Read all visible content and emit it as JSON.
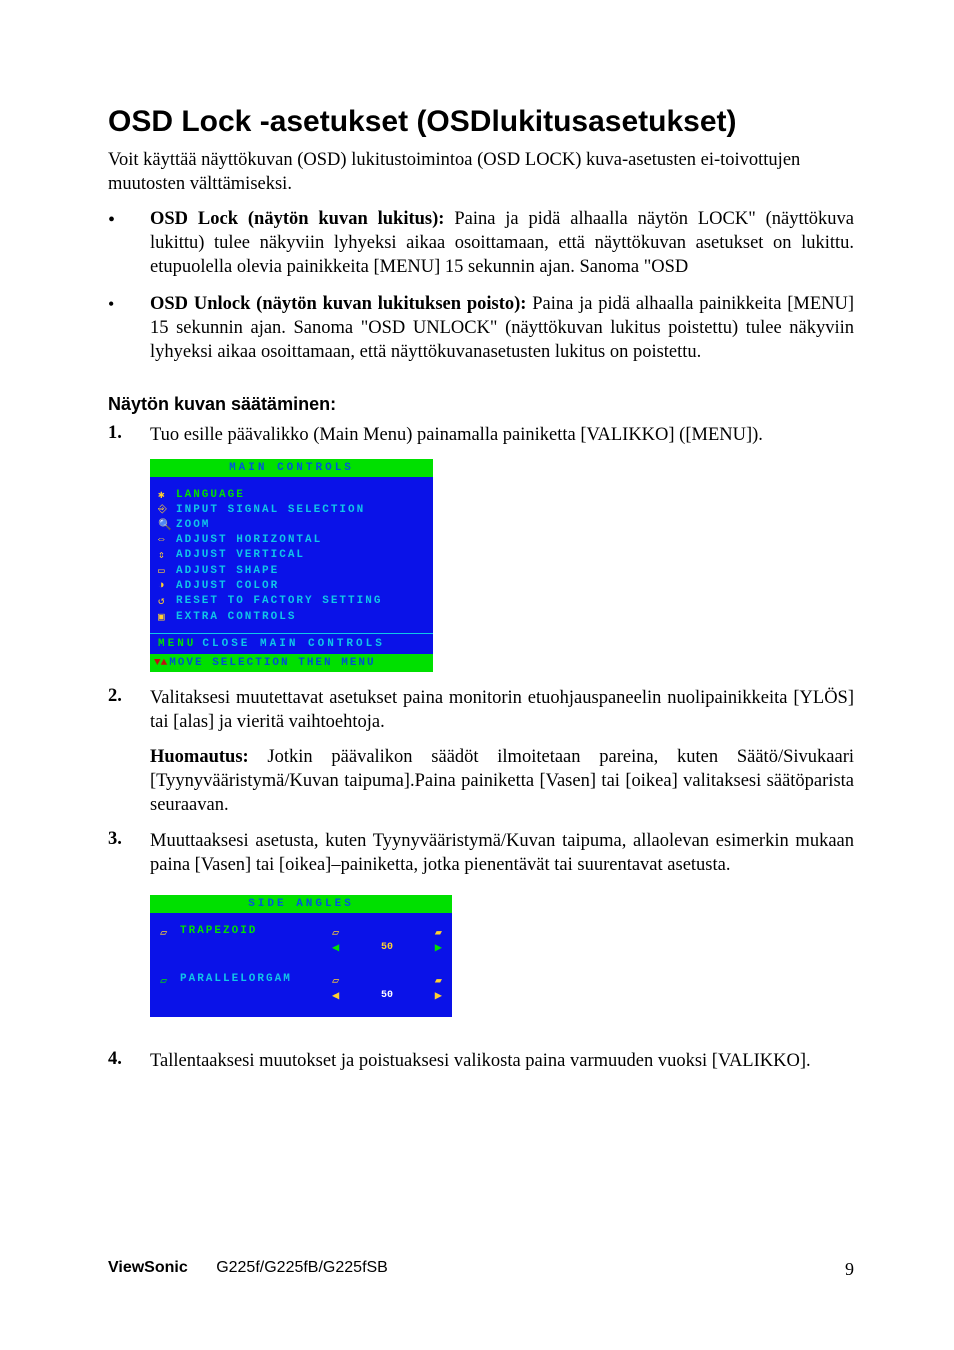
{
  "title": "OSD Lock -asetukset (OSDlukitusasetukset)",
  "intro": "Voit käyttää näyttökuvan (OSD) lukitustoimintoa (OSD LOCK) kuva-asetusten ei-toivottujen muutosten välttämiseksi.",
  "bullets": [
    {
      "lead": "OSD Lock (näytön kuvan lukitus):",
      "text": " Paina ja pidä alhaalla näytön LOCK\" (näyttökuva lukittu) tulee näkyviin lyhyeksi aikaa osoittamaan, että näyttökuvan asetukset on lukittu. etupuolella olevia painikkeita [MENU] 15 sekunnin ajan. Sanoma \"OSD"
    },
    {
      "lead": "OSD Unlock (näytön kuvan lukituksen poisto):",
      "text": " Paina ja pidä alhaalla painikkeita [MENU] 15 sekunnin ajan. Sanoma \"OSD UNLOCK\" (näyttökuvan lukitus poistettu) tulee näkyviin lyhyeksi aikaa osoittamaan, että näyttökuvanasetusten lukitus on poistettu."
    }
  ],
  "subhead": "Näytön kuvan säätäminen:",
  "steps": [
    {
      "n": "1.",
      "text": "Tuo esille päävalikko (Main Menu) painamalla painiketta [VALIKKO] ([MENU])."
    },
    {
      "n": "2.",
      "text": "Valitaksesi muutettavat asetukset paina monitorin etuohjauspaneelin nuolipainikkeita [YLÖS] tai [alas] ja vieritä vaihtoehtoja.",
      "note_lead": "Huomautus:",
      "note_text": " Jotkin päävalikon säädöt ilmoitetaan pareina, kuten Säätö/Sivukaari [Tyynyvääristymä/Kuvan taipuma].Paina painiketta [Vasen] tai [oikea] valitaksesi säätöparista seuraavan."
    },
    {
      "n": "3.",
      "text": "Muuttaaksesi asetusta, kuten Tyynyvääristymä/Kuvan taipuma, allaolevan esimerkin mukaan paina [Vasen] tai [oikea]–painiketta, jotka pienentävät tai suurentavat asetusta."
    },
    {
      "n": "4.",
      "text": "Tallentaaksesi muutokset ja poistuaksesi valikosta paina varmuuden vuoksi [VALIKKO]."
    }
  ],
  "osd_main": {
    "title": "MAIN CONTROLS",
    "items": [
      "LANGUAGE",
      "INPUT SIGNAL SELECTION",
      "ZOOM",
      "ADJUST HORIZONTAL",
      "ADJUST VERTICAL",
      "ADJUST SHAPE",
      "ADJUST COLOR",
      "RESET TO FACTORY SETTING",
      "EXTRA CONTROLS"
    ],
    "close_prefix": "MENU",
    "close_text": "CLOSE MAIN CONTROLS",
    "hint": "MOVE SELECTION THEN MENU"
  },
  "osd_side": {
    "title": "SIDE ANGLES",
    "rows": [
      {
        "label": "TRAPEZOID",
        "value": "50"
      },
      {
        "label": "PARALLELORGAM",
        "value": "50"
      }
    ]
  },
  "chart_data": {
    "type": "table",
    "title": "SIDE ANGLES OSD values",
    "rows": [
      {
        "setting": "TRAPEZOID",
        "value": 50,
        "range": [
          0,
          100
        ]
      },
      {
        "setting": "PARALLELORGAM",
        "value": 50,
        "range": [
          0,
          100
        ]
      }
    ]
  },
  "footer": {
    "brand": "ViewSonic",
    "model": "G225f/G225fB/G225fSB",
    "page": "9"
  }
}
